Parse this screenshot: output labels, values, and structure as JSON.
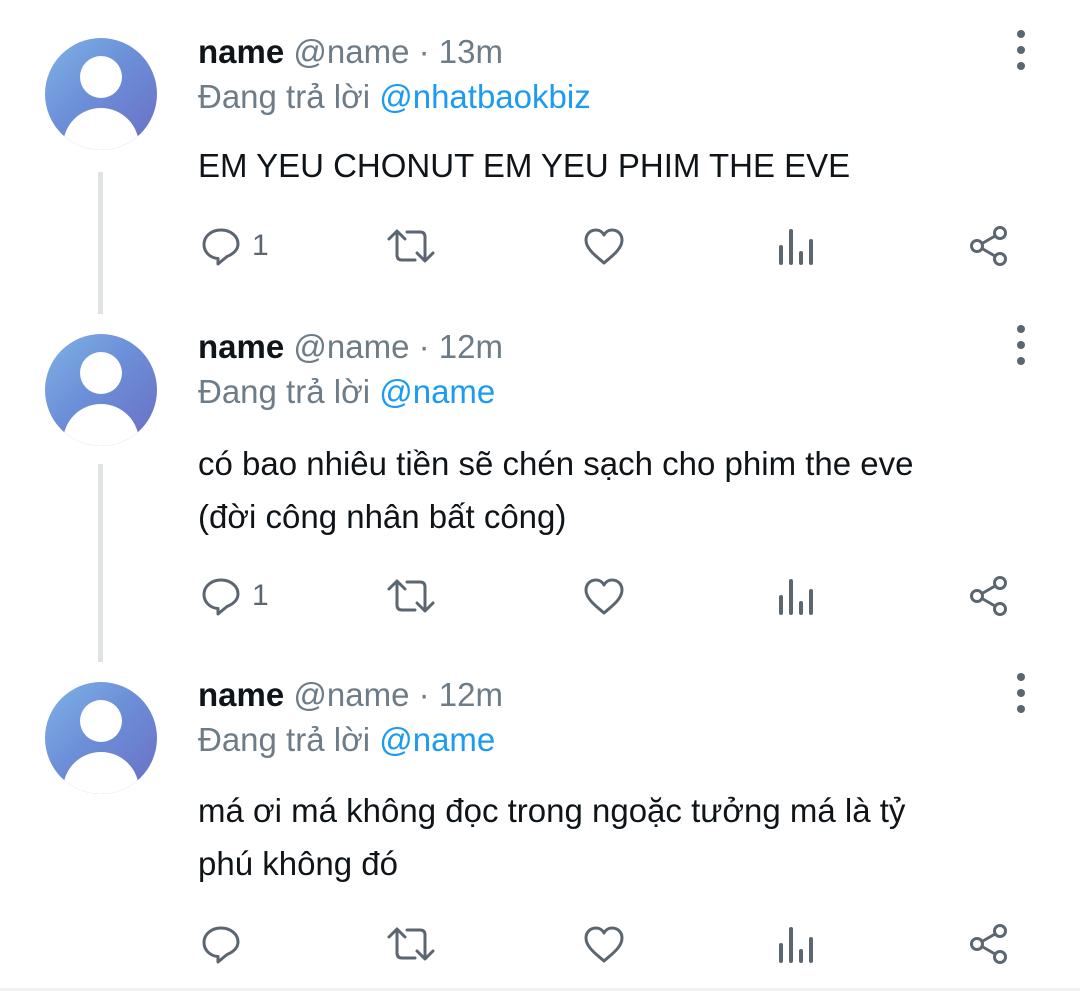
{
  "replies": [
    {
      "name": "name",
      "handle": "@name",
      "separator": "·",
      "time": "13m",
      "reply_prefix": "Đang trả lời",
      "reply_to": "@nhatbaokbiz",
      "text_lines": [
        "EM YEU CHONUT EM YEU PHIM THE EVE"
      ],
      "reply_count": "1"
    },
    {
      "name": "name",
      "handle": "@name",
      "separator": "·",
      "time": "12m",
      "reply_prefix": "Đang trả lời",
      "reply_to": "@name",
      "text_lines": [
        "có bao nhiêu tiền sẽ chén sạch cho phim the eve",
        "(đời công nhân bất công)"
      ],
      "reply_count": "1"
    },
    {
      "name": "name",
      "handle": "@name",
      "separator": "·",
      "time": "12m",
      "reply_prefix": "Đang trả lời",
      "reply_to": "@name",
      "text_lines": [
        "má ơi má không đọc trong ngoặc tưởng má là tỷ",
        "phú không đó"
      ],
      "reply_count": ""
    }
  ],
  "icons": {
    "avatar": "default-avatar-icon",
    "more": "more-vertical-icon",
    "reply": "reply-bubble-icon",
    "retweet": "retweet-icon",
    "like": "heart-icon",
    "views": "views-bar-chart-icon",
    "share": "share-icon"
  },
  "colors": {
    "mention": "#1d9bf0",
    "secondary_text": "#6e7c87",
    "primary_text": "#0f1419",
    "thread_line": "#dfe3e6"
  }
}
